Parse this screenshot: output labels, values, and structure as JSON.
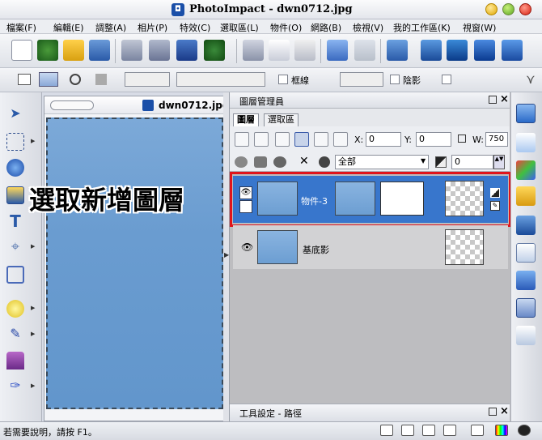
{
  "window": {
    "title": "PhotoImpact - dwn0712.jpg",
    "controls": [
      "minimize-icon",
      "maximize-icon",
      "close-icon"
    ]
  },
  "menubar": {
    "items": [
      "檔案(F)",
      "編輯(E)",
      "調整(A)",
      "相片(P)",
      "特效(C)",
      "選取區(L)",
      "物件(O)",
      "網路(B)",
      "檢視(V)",
      "我的工作區(K)",
      "視窗(W)"
    ]
  },
  "toolbar2": {
    "frame_label": "框線",
    "shadow_label": "陰影"
  },
  "document": {
    "title": "dwn0712.jpg",
    "canvas_color": "#6a9cd0"
  },
  "annotation": {
    "text": "選取新增圖層"
  },
  "layer_manager": {
    "title": "圖層管理員",
    "tabs": [
      "圖層",
      "選取區"
    ],
    "x_label": "X:",
    "x_value": "0",
    "y_label": "Y:",
    "y_value": "0",
    "w_label": "W:",
    "w_value": "750",
    "filter_value": "全部",
    "opacity_value": "0",
    "layers": [
      {
        "name": "物件-3",
        "selected": true
      },
      {
        "name": "基底影",
        "selected": false
      }
    ],
    "highlight_color": "#e0141c",
    "selected_color": "#3876cc"
  },
  "tool_settings": {
    "title": "工具設定 - 路徑"
  },
  "statusbar": {
    "text": "若需要說明，請按 F1。"
  }
}
